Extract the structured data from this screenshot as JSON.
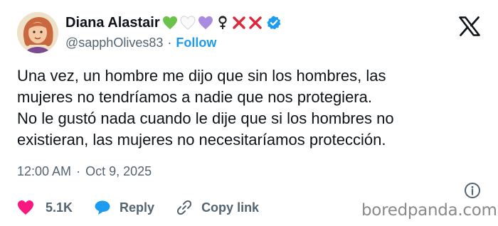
{
  "author": {
    "display_name": "Diana Alastair",
    "handle": "@sapphOlives83",
    "follow_label": "Follow",
    "name_emojis": [
      "green-heart",
      "white-heart",
      "purple-heart",
      "female-sign",
      "cross-mark",
      "cross-mark"
    ],
    "verified": true
  },
  "tweet": {
    "lines": [
      "Una vez, un hombre me dijo que sin los hombres, las",
      "mujeres no tendríamos a nadie que nos protegiera.",
      "No le gustó nada cuando le dije que si los hombres no",
      "existieran, las mujeres no necesitaríamos protección."
    ],
    "time": "12:00 AM",
    "separator": "·",
    "date": "Oct 9, 2025"
  },
  "actions": {
    "like_count": "5.1K",
    "reply_label": "Reply",
    "copy_link_label": "Copy link"
  },
  "watermark": "boredpanda.com",
  "colors": {
    "text": "#0f1419",
    "secondary": "#536471",
    "link_blue": "#1d9bf0",
    "like_pink": "#f91880",
    "green_heart": "#6cc24a",
    "purple_heart": "#a98be0",
    "cross_red": "#e0263a"
  }
}
